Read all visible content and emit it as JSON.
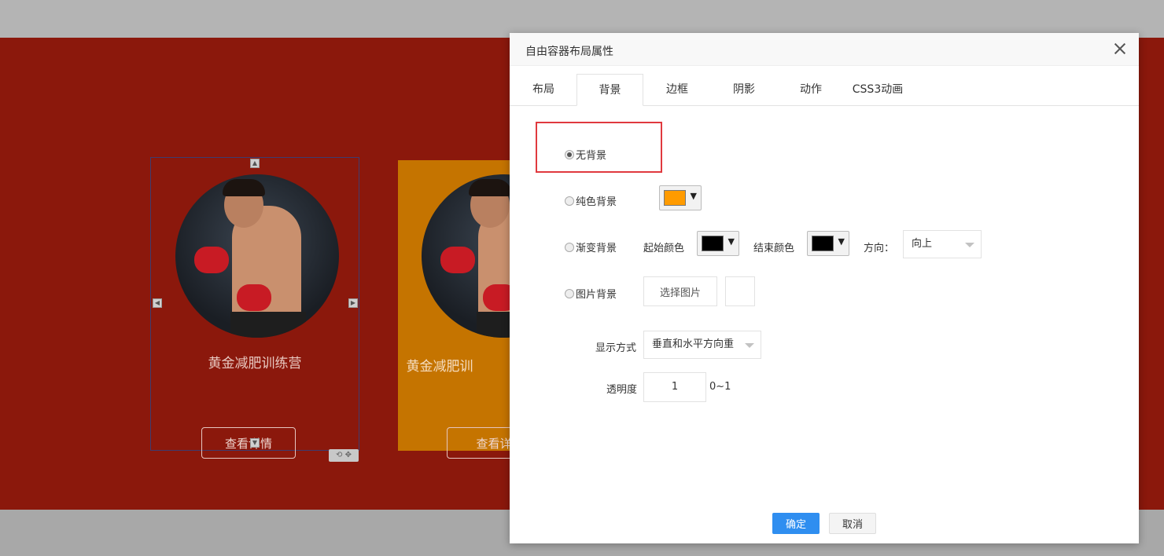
{
  "canvas": {
    "cards": [
      {
        "title": "黄金减肥训练营",
        "button": "查看详情"
      },
      {
        "title": "黄金减肥训",
        "button": "查看详"
      }
    ]
  },
  "dialog": {
    "title": "自由容器布局属性",
    "tabs": [
      "布局",
      "背景",
      "边框",
      "阴影",
      "动作",
      "CSS3动画"
    ],
    "active_tab": "背景",
    "options": {
      "none": "无背景",
      "solid": "纯色背景",
      "gradient": "渐变背景",
      "image": "图片背景"
    },
    "selected_option": "无背景",
    "solid_color": "#ff9b00",
    "gradient": {
      "start_label": "起始颜色",
      "start_color": "#000000",
      "end_label": "结束颜色",
      "end_color": "#000000",
      "direction_label": "方向：",
      "direction_value": "向上"
    },
    "image": {
      "choose_label": "选择图片"
    },
    "display_mode": {
      "label": "显示方式",
      "value": "垂直和水平方向重"
    },
    "opacity": {
      "label": "透明度",
      "value": "1",
      "range": "0~1"
    },
    "ok_label": "确定",
    "cancel_label": "取消"
  },
  "colors": {
    "canvas_bg": "#8b180c",
    "card2_bg": "#c57400",
    "highlight": "#e0393e",
    "primary": "#2f8ef0"
  }
}
